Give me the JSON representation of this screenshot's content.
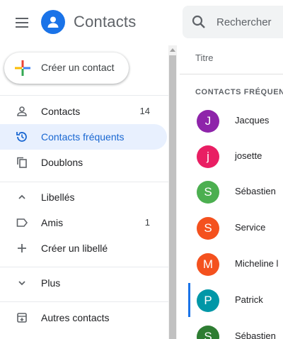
{
  "header": {
    "app_title": "Contacts",
    "search_placeholder": "Rechercher"
  },
  "sidebar": {
    "create_label": "Créer un contact",
    "items": [
      {
        "label": "Contacts",
        "count": "14",
        "icon": "person-icon"
      },
      {
        "label": "Contacts fréquents",
        "count": "",
        "icon": "history-icon",
        "active": true
      },
      {
        "label": "Doublons",
        "count": "",
        "icon": "copy-icon"
      }
    ],
    "labels_section": {
      "header": "Libellés",
      "items": [
        {
          "label": "Amis",
          "count": "1",
          "icon": "label-icon"
        },
        {
          "label": "Créer un libellé",
          "count": "",
          "icon": "plus-icon"
        }
      ]
    },
    "more_label": "Plus",
    "other_contacts_label": "Autres contacts"
  },
  "main": {
    "column_header": "Titre",
    "section_title": "CONTACTS FRÉQUENTS",
    "contacts": [
      {
        "initial": "J",
        "name": "Jacques",
        "color": "#8e24aa"
      },
      {
        "initial": "j",
        "name": "josette",
        "color": "#e91e63"
      },
      {
        "initial": "S",
        "name": "Sébastien",
        "color": "#4caf50"
      },
      {
        "initial": "S",
        "name": "Service",
        "color": "#f4511e"
      },
      {
        "initial": "M",
        "name": "Micheline l",
        "color": "#f4511e"
      },
      {
        "initial": "P",
        "name": "Patrick",
        "color": "#0097a7",
        "selected": true
      },
      {
        "initial": "S",
        "name": "Sébastien",
        "color": "#2e7d32"
      }
    ]
  },
  "colors": {
    "accent": "#1a73e8",
    "active_bg": "#e8f0fe",
    "active_text": "#1967d2"
  }
}
